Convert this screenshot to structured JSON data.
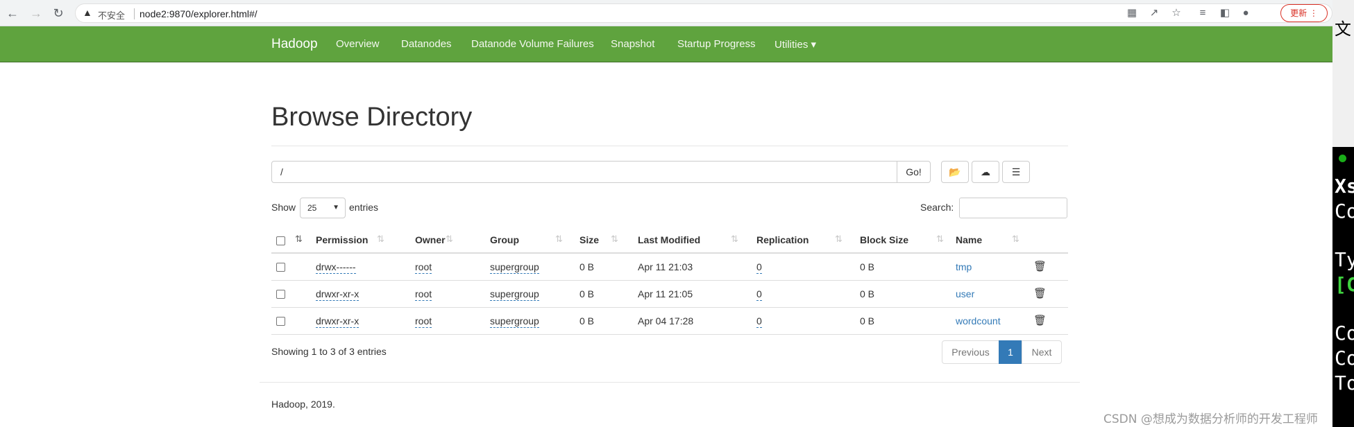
{
  "browser": {
    "back_icon": "←",
    "forward_icon": "→",
    "reload_icon": "↻",
    "insecure_label": "不安全",
    "url": "node2:9870/explorer.html#/",
    "update_label": "更新 ⋮"
  },
  "navbar": {
    "brand": "Hadoop",
    "links": [
      "Overview",
      "Datanodes",
      "Datanode Volume Failures",
      "Snapshot",
      "Startup Progress",
      "Utilities ▾"
    ]
  },
  "page": {
    "title": "Browse Directory",
    "path_value": "/",
    "go_label": "Go!",
    "show_label": "Show",
    "entries_value": "25",
    "entries_label": "entries",
    "search_label": "Search:"
  },
  "table": {
    "columns": [
      "Permission",
      "Owner",
      "Group",
      "Size",
      "Last Modified",
      "Replication",
      "Block Size",
      "Name"
    ],
    "rows": [
      {
        "permission": "drwx------",
        "owner": "root",
        "group": "supergroup",
        "size": "0 B",
        "modified": "Apr 11 21:03",
        "replication": "0",
        "block_size": "0 B",
        "name": "tmp"
      },
      {
        "permission": "drwxr-xr-x",
        "owner": "root",
        "group": "supergroup",
        "size": "0 B",
        "modified": "Apr 11 21:05",
        "replication": "0",
        "block_size": "0 B",
        "name": "user"
      },
      {
        "permission": "drwxr-xr-x",
        "owner": "root",
        "group": "supergroup",
        "size": "0 B",
        "modified": "Apr 04 17:28",
        "replication": "0",
        "block_size": "0 B",
        "name": "wordcount"
      }
    ]
  },
  "pagination": {
    "info": "Showing 1 to 3 of 3 entries",
    "previous": "Previous",
    "current": "1",
    "next": "Next"
  },
  "footer": "Hadoop, 2019.",
  "side_window": {
    "line1": "文",
    "line2": "Xs",
    "line3": "Co",
    "line4": "Ty",
    "line5": "[C",
    "line6": "Co",
    "line7": "Co",
    "line8": "To"
  },
  "watermark": "CSDN @想成为数据分析师的开发工程师",
  "colors": {
    "navbar": "#5fa33e",
    "link": "#337ab7"
  }
}
